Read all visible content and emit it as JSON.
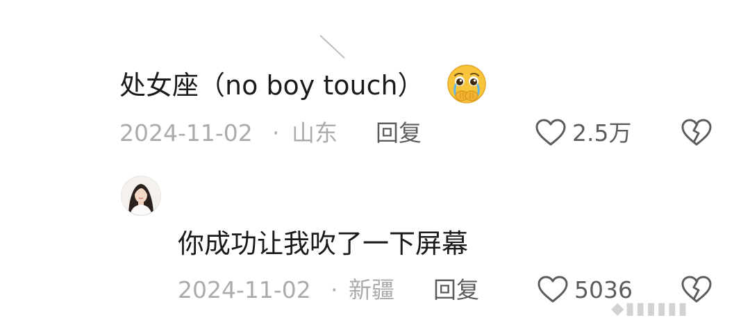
{
  "comments": [
    {
      "text": "处女座（no boy touch）",
      "emoji": "crying-pleading-face-emoji",
      "date": "2024-11-02",
      "separator": "·",
      "location": "山东",
      "reply_label": "回复",
      "like_count": "2.5万"
    },
    {
      "text": "你成功让我吹了一下屏幕",
      "avatar": "woman-portrait-avatar",
      "date": "2024-11-02",
      "separator": "·",
      "location": "新疆",
      "reply_label": "回复",
      "like_count": "5036"
    }
  ],
  "watermark": "◆▮▮▮▮▮▮",
  "colors": {
    "text": "#1a1a1a",
    "meta": "#ababab",
    "action": "#5c5c5c",
    "emoji": "#f7c43b"
  }
}
